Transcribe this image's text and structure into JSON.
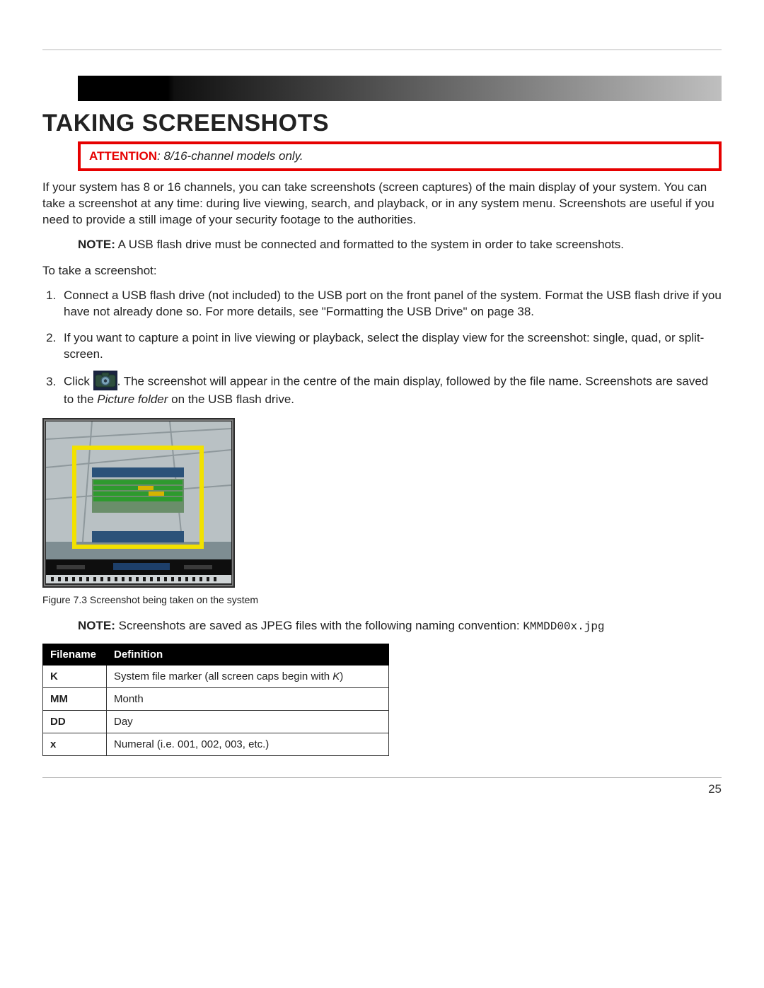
{
  "heading": "TAKING SCREENSHOTS",
  "attention": {
    "label": "ATTENTION",
    "text": ": 8/16-channel models only."
  },
  "intro": "If your system has 8 or 16 channels, you can take screenshots (screen captures) of the main display of your system. You can take a screenshot at any time: during live viewing, search, and playback, or in any system menu. Screenshots are useful if you need to provide a still image of your security footage to the authorities.",
  "note1": {
    "label": "NOTE:",
    "text": " A USB flash drive must be connected and formatted to the system in order to take screenshots."
  },
  "to_take": "To take a screenshot:",
  "steps": [
    "Connect a USB flash drive (not included) to the USB port on the front panel of the system. Format the USB flash drive if you have not already done so. For more details, see \"Formatting the USB Drive\" on page 38.",
    "If you want to capture a point in live viewing or playback, select the display view for the screenshot: single, quad, or split-screen."
  ],
  "step3": {
    "pre": "Click ",
    "post": ". The screenshot will appear in the centre of the main display, followed by the file name. Screenshots are saved to the ",
    "folder": "Picture folder",
    "tail": " on the USB flash drive."
  },
  "figure_caption": "Figure 7.3 Screenshot being taken on the system",
  "note2": {
    "label": "NOTE:",
    "text": " Screenshots are saved as JPEG files with the following naming convention: ",
    "code": "KMMDD00x.jpg"
  },
  "table": {
    "headers": [
      "Filename",
      "Definition"
    ],
    "rows": [
      {
        "fn": "K",
        "def_pre": "System file marker (all screen caps begin with ",
        "def_it": "K",
        "def_post": ")"
      },
      {
        "fn": "MM",
        "def_pre": "Month",
        "def_it": "",
        "def_post": ""
      },
      {
        "fn": "DD",
        "def_pre": "Day",
        "def_it": "",
        "def_post": ""
      },
      {
        "fn": "x",
        "def_pre": "Numeral (i.e. 001, 002, 003, etc.)",
        "def_it": "",
        "def_post": ""
      }
    ]
  },
  "page_number": "25"
}
